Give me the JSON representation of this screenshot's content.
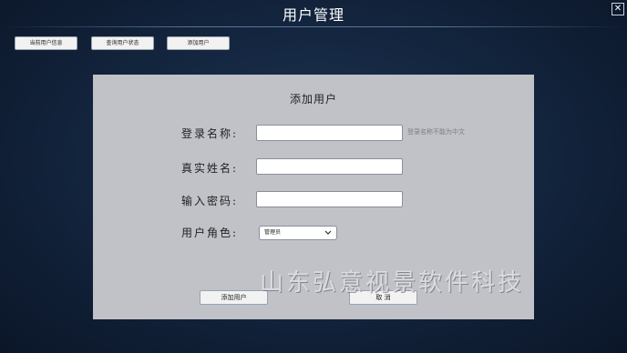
{
  "window": {
    "title": "用户管理",
    "close_symbol": "✕"
  },
  "toolbar": {
    "buttons": [
      {
        "label": "当前用户信息"
      },
      {
        "label": "查询用户状态"
      },
      {
        "label": "添加用户"
      }
    ]
  },
  "form": {
    "title": "添加用户",
    "fields": {
      "login_name": {
        "label": "登录名称:",
        "value": "",
        "hint": "登录名称不能为中文"
      },
      "real_name": {
        "label": "真实姓名:",
        "value": ""
      },
      "password": {
        "label": "输入密码:",
        "value": ""
      },
      "role": {
        "label": "用户角色:",
        "selected": "管理员"
      }
    },
    "submit_label": "添加用户",
    "cancel_label": "取 消"
  },
  "watermark": {
    "text": "山东弘意视景软件科技"
  },
  "icons": {
    "close": "close-icon",
    "dropdown": "chevron-down-icon"
  },
  "colors": {
    "background": "#142640",
    "panel": "#c0c2c8",
    "button": "#f2f2f2",
    "title_text": "#ffffff"
  }
}
